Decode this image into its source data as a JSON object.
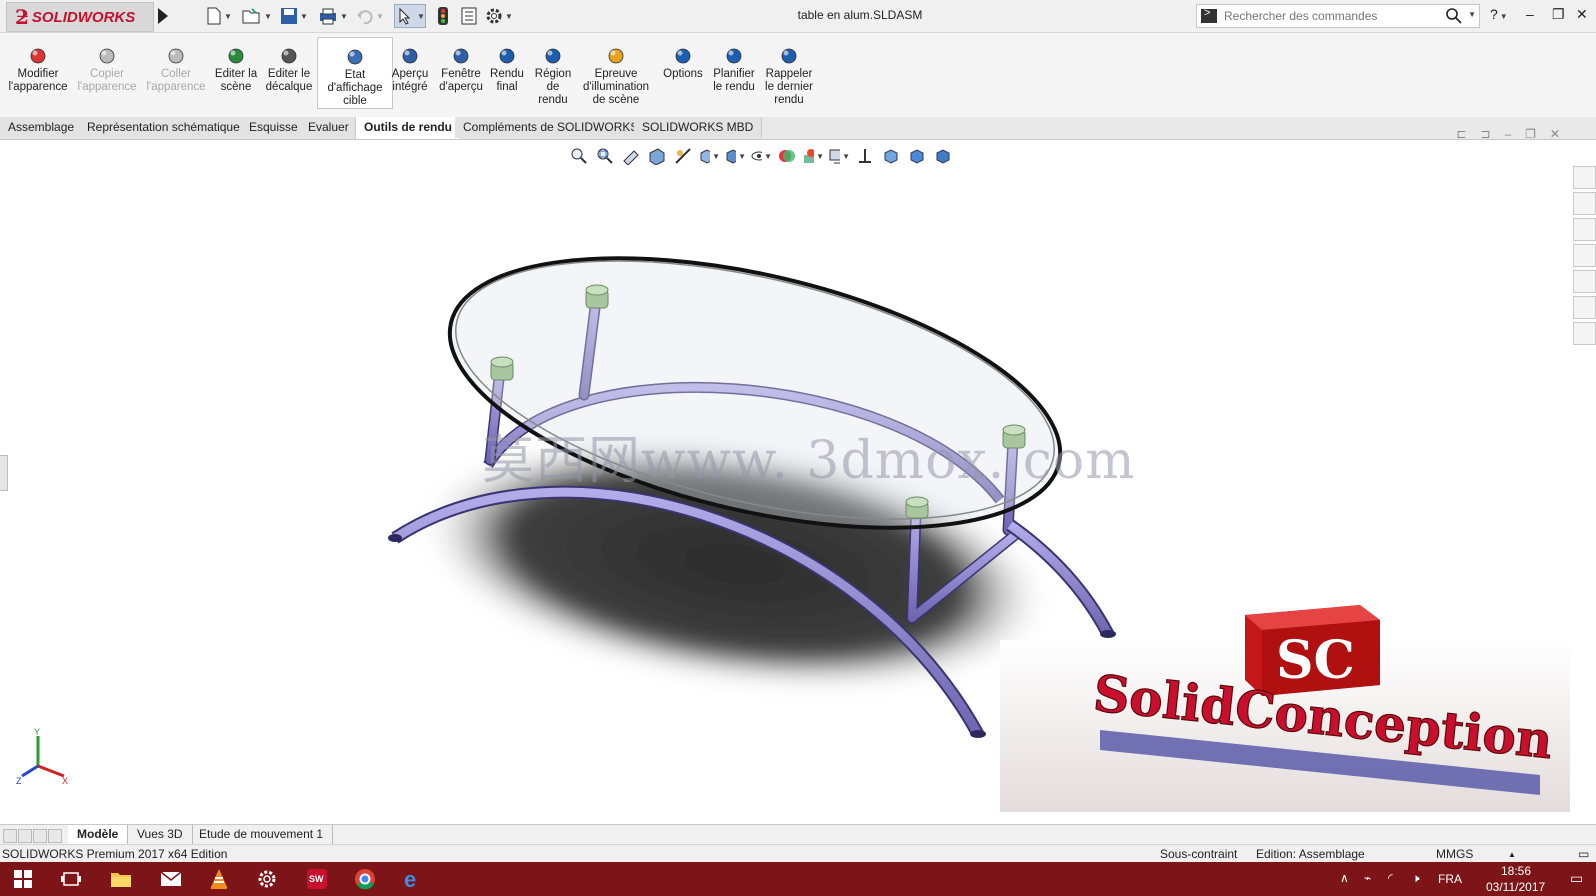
{
  "app": {
    "logo_text": "SOLIDWORKS",
    "document_title": "table en alum.SLDASM"
  },
  "search": {
    "placeholder": "Rechercher des commandes"
  },
  "ribbon": {
    "buttons": [
      {
        "lines": [
          "Modifier",
          "l'apparence"
        ],
        "state": "enabled",
        "icon": "appearance-icon"
      },
      {
        "lines": [
          "Copier",
          "l'apparence"
        ],
        "state": "disabled",
        "icon": "copy-appearance-icon"
      },
      {
        "lines": [
          "Coller",
          "l'apparence"
        ],
        "state": "disabled",
        "icon": "paste-appearance-icon"
      },
      {
        "lines": [
          "Editer la",
          "scène"
        ],
        "state": "enabled",
        "icon": "scene-icon"
      },
      {
        "lines": [
          "Editer le",
          "décalque"
        ],
        "state": "enabled",
        "icon": "decal-icon"
      },
      {
        "lines": [
          "Etat",
          "d'affichage",
          "cible"
        ],
        "state": "active",
        "icon": "target-icon"
      },
      {
        "lines": [
          "Aperçu",
          "intégré"
        ],
        "state": "enabled",
        "icon": "preview-icon"
      },
      {
        "lines": [
          "Fenêtre",
          "d'aperçu"
        ],
        "state": "enabled",
        "icon": "preview-window-icon"
      },
      {
        "lines": [
          "Rendu",
          "final"
        ],
        "state": "enabled",
        "icon": "render-icon"
      },
      {
        "lines": [
          "Région",
          "de",
          "rendu"
        ],
        "state": "enabled",
        "icon": "render-region-icon"
      },
      {
        "lines": [
          "Epreuve",
          "d'illumination",
          "de scène"
        ],
        "state": "enabled",
        "icon": "illumination-icon"
      },
      {
        "lines": [
          "Options"
        ],
        "state": "enabled",
        "icon": "options-icon"
      },
      {
        "lines": [
          "Planifier",
          "le rendu"
        ],
        "state": "enabled",
        "icon": "schedule-icon"
      },
      {
        "lines": [
          "Rappeler",
          "le dernier",
          "rendu"
        ],
        "state": "enabled",
        "icon": "recall-render-icon"
      }
    ]
  },
  "tabs": [
    {
      "label": "Assemblage",
      "active": false
    },
    {
      "label": "Représentation schématique",
      "active": false
    },
    {
      "label": "Esquisse",
      "active": false
    },
    {
      "label": "Evaluer",
      "active": false
    },
    {
      "label": "Outils de rendu",
      "active": true
    },
    {
      "label": "Compléments de SOLIDWORKS",
      "active": false
    },
    {
      "label": "SOLIDWORKS MBD",
      "active": false
    }
  ],
  "viewport": {
    "watermark": "莫西网www. 3dmox. com",
    "logo_badge": "SC",
    "logo_text": "SolidConception",
    "triad_labels": [
      "Y",
      "Z",
      "X"
    ]
  },
  "model_tabs": [
    {
      "label": "Modèle",
      "active": true
    },
    {
      "label": "Vues 3D",
      "active": false
    },
    {
      "label": "Etude de mouvement 1",
      "active": false
    }
  ],
  "status": {
    "product": "SOLIDWORKS Premium 2017 x64 Edition",
    "constraint": "Sous-contraint",
    "mode": "Edition: Assemblage",
    "units": "MMGS"
  },
  "taskbar": {
    "language": "FRA",
    "time": "18:56",
    "date": "03/11/2017"
  },
  "colors": {
    "brand_red": "#c8102e",
    "taskbar": "#7d1518",
    "tube_purple": "#8c84c8"
  }
}
